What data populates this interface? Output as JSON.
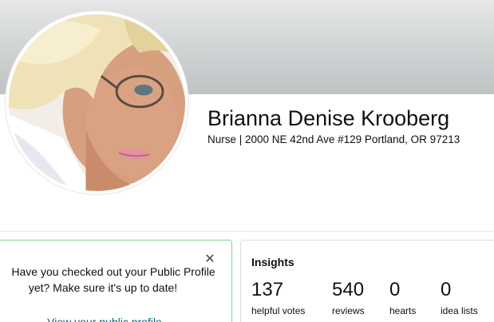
{
  "profile": {
    "name": "Brianna Denise Krooberg",
    "subline": "Nurse | 2000 NE 42nd Ave #129 Portland, OR 97213"
  },
  "prompt_card": {
    "line1": "Have you checked out your Public Profile",
    "line2": "yet? Make sure it's up to date!",
    "link": "View your public profile",
    "close_icon": "close-icon",
    "border_color": "#7fd38b"
  },
  "insights": {
    "title": "Insights",
    "stats": [
      {
        "value": "137",
        "label": "helpful votes"
      },
      {
        "value": "540",
        "label": "reviews"
      },
      {
        "value": "0",
        "label": "hearts"
      },
      {
        "value": "0",
        "label": "idea lists"
      }
    ]
  },
  "colors": {
    "link": "#007185",
    "banner": "#cfd2d3"
  }
}
